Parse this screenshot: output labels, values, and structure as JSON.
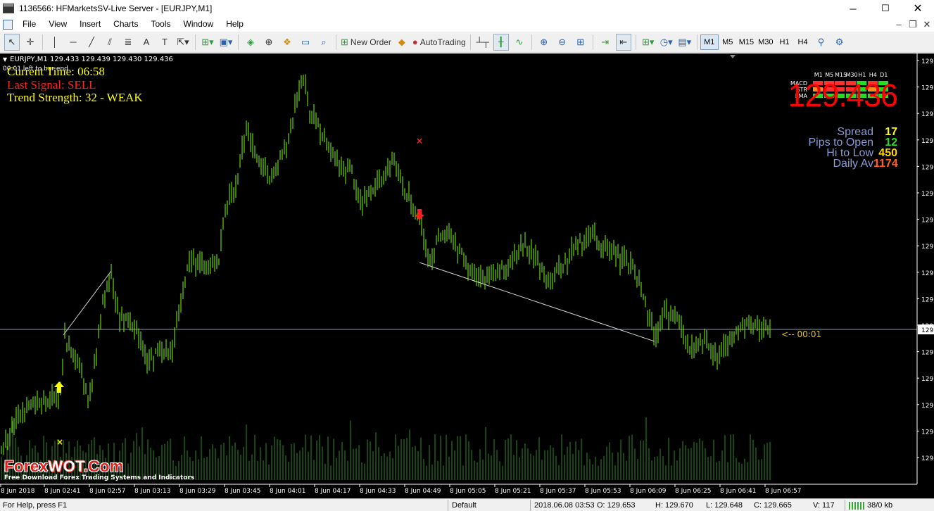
{
  "window": {
    "title": "1136566: HFMarketsSV-Live Server - [EURJPY,M1]",
    "controls": [
      "─",
      "☐",
      "✕"
    ]
  },
  "menu": {
    "items": [
      "File",
      "View",
      "Insert",
      "Charts",
      "Tools",
      "Window",
      "Help"
    ],
    "right_controls": [
      "–",
      "❐",
      "✕"
    ]
  },
  "toolbar": {
    "new_order_label": "New Order",
    "autotrading_label": "AutoTrading",
    "timeframes": [
      "M1",
      "M5",
      "M15",
      "M30",
      "H1",
      "H4"
    ],
    "active_timeframe": "M1"
  },
  "chart": {
    "header": "EURJPY,M1  129.433 129.439 129.430 129.436",
    "left_to_bar": "00:01 left to bar end",
    "current_time": "Current Time: 06:58",
    "last_signal": "Last Signal: SELL",
    "trend_strength": "Trend Strength: 32 - WEAK",
    "countdown": "<-- 00:01",
    "price_axis_label": "129.",
    "time_labels": [
      "8 Jun 2018",
      "8 Jun 02:41",
      "8 Jun 02:57",
      "8 Jun 03:13",
      "8 Jun 03:29",
      "8 Jun 03:45",
      "8 Jun 04:01",
      "8 Jun 04:17",
      "8 Jun 04:33",
      "8 Jun 04:49",
      "8 Jun 05:05",
      "8 Jun 05:21",
      "8 Jun 05:37",
      "8 Jun 05:53",
      "8 Jun 06:09",
      "8 Jun 06:25",
      "8 Jun 06:41",
      "8 Jun 06:57"
    ],
    "colors": {
      "background": "#000000",
      "candles": "#7cfc00",
      "volume": "#2e8b20",
      "buy_arrow": "#ffff00",
      "sell_arrow": "#ff2020",
      "current_time": "#ffff00",
      "last_signal": "#ff2020",
      "trend_strength": "#ffff00"
    }
  },
  "panel": {
    "timeframes": [
      "M1",
      "M5",
      "M15",
      "M30",
      "H1",
      "H4",
      "D1"
    ],
    "indicators": [
      "MACD",
      "STR",
      "EMA"
    ],
    "cells": [
      [
        "#ff3030",
        "#ff3030",
        "#ff3030",
        "#ff3030",
        "#22dd22",
        "#ff3030",
        "#22dd22"
      ],
      [
        "#ff8c20",
        "#ff3030",
        "#ff3030",
        "#ff3030",
        "#22dd22",
        "#ff8c20",
        "#22dd22"
      ],
      [
        "#22dd22",
        "#22dd22",
        "#22dd22",
        "#22dd22",
        "#22dd22",
        "#22dd22",
        "#22dd22"
      ]
    ],
    "price": "129.436",
    "stats": [
      {
        "label": "Spread",
        "value": "17",
        "color": "#ffff00"
      },
      {
        "label": "Pips to Open",
        "value": "12",
        "color": "#22dd22"
      },
      {
        "label": "Hi to Low",
        "value": "450",
        "color": "#ffd700"
      },
      {
        "label": "Daily Av",
        "value": "1174",
        "color": "#ff6020"
      }
    ]
  },
  "watermark": {
    "main_red": "Forex",
    "main_white": "WOT",
    "main_red2": ".Com",
    "sub": "Free Download Forex Trading Systems and Indicators"
  },
  "status": {
    "help": "For Help, press F1",
    "profile": "Default",
    "datetime": "2018.06.08 03:53",
    "open": "O: 129.653",
    "high": "H: 129.670",
    "low": "L: 129.648",
    "close": "C: 129.665",
    "volume": "V: 117",
    "traffic": "38/0 kb"
  }
}
